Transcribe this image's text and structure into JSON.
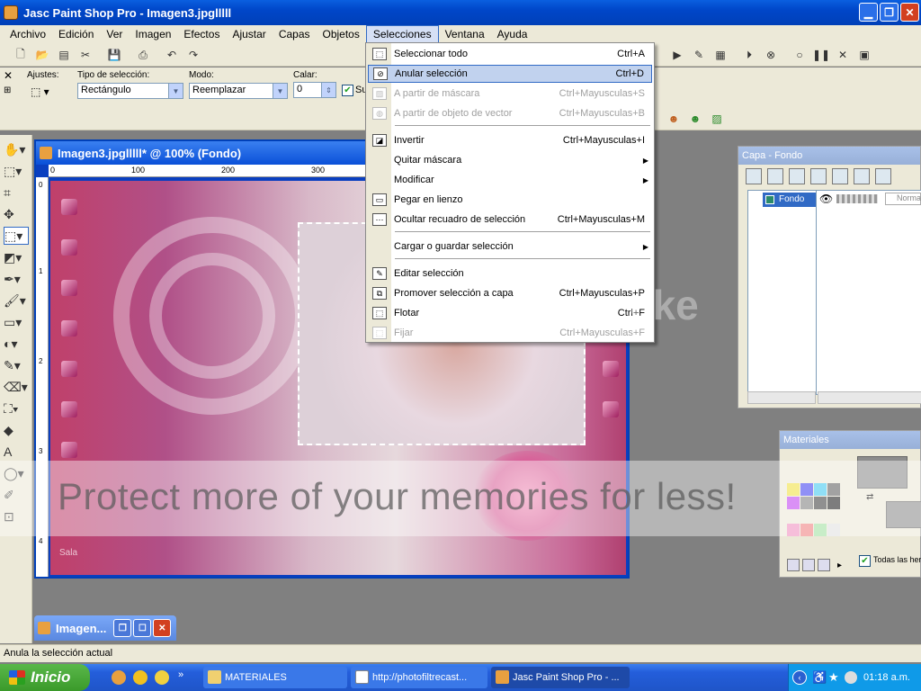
{
  "window": {
    "title": "Jasc Paint Shop Pro - Imagen3.jpglllll"
  },
  "menubar": [
    "Archivo",
    "Edición",
    "Ver",
    "Imagen",
    "Efectos",
    "Ajustar",
    "Capas",
    "Objetos",
    "Selecciones",
    "Ventana",
    "Ayuda"
  ],
  "tool_options": {
    "ajustes_label": "Ajustes:",
    "tipo_label": "Tipo de selección:",
    "tipo_value": "Rectángulo",
    "modo_label": "Modo:",
    "modo_value": "Reemplazar",
    "calar_label": "Calar:",
    "calar_value": "0",
    "su_label": "Su"
  },
  "selecciones_menu": [
    {
      "label": "Seleccionar todo",
      "shortcut": "Ctrl+A",
      "enabled": true,
      "icon": "select-all-icon"
    },
    {
      "label": "Anular selección",
      "shortcut": "Ctrl+D",
      "enabled": true,
      "highlighted": true,
      "icon": "deselect-icon"
    },
    {
      "label": "A partir de máscara",
      "shortcut": "Ctrl+Mayusculas+S",
      "enabled": false,
      "icon": "from-mask-icon"
    },
    {
      "label": "A partir de objeto de vector",
      "shortcut": "Ctrl+Mayusculas+B",
      "enabled": false,
      "icon": "from-vector-icon"
    },
    {
      "label": "Invertir",
      "shortcut": "Ctrl+Mayusculas+I",
      "enabled": true,
      "icon": "invert-icon"
    },
    {
      "label": "Quitar máscara",
      "shortcut": "",
      "enabled": true,
      "submenu": true
    },
    {
      "label": "Modificar",
      "shortcut": "",
      "enabled": true,
      "submenu": true
    },
    {
      "label": "Pegar en lienzo",
      "shortcut": "",
      "enabled": true,
      "icon": "paste-canvas-icon"
    },
    {
      "label": "Ocultar recuadro de selección",
      "shortcut": "Ctrl+Mayusculas+M",
      "enabled": true,
      "icon": "hide-marquee-icon"
    },
    {
      "label": "Cargar o guardar selección",
      "shortcut": "",
      "enabled": true,
      "submenu": true
    },
    {
      "label": "Editar selección",
      "shortcut": "",
      "enabled": true,
      "icon": "edit-selection-icon"
    },
    {
      "label": "Promover selección a capa",
      "shortcut": "Ctrl+Mayusculas+P",
      "enabled": true,
      "icon": "promote-layer-icon"
    },
    {
      "label": "Flotar",
      "shortcut": "Ctrl+F",
      "enabled": true,
      "icon": "float-icon"
    },
    {
      "label": "Fijar",
      "shortcut": "Ctrl+Mayusculas+F",
      "enabled": false,
      "icon": "defloat-icon"
    }
  ],
  "image_window": {
    "title": "Imagen3.jpglllll* @ 100% (Fondo)",
    "ruler_h": [
      "0",
      "100",
      "200",
      "300"
    ],
    "ruler_v": [
      "0",
      "1",
      "2",
      "3",
      "4"
    ]
  },
  "canvas_signature": "Sala",
  "minimized_window": {
    "title": "Imagen..."
  },
  "layer_palette": {
    "title": "Capa - Fondo",
    "layer_name": "Fondo",
    "blend_mode": "Norma"
  },
  "materials_palette": {
    "title": "Materiales",
    "checkbox_label": "Todas las herr"
  },
  "status_text": "Anula la selección actual",
  "taskbar": {
    "start_label": "Inicio",
    "tasks": [
      "MATERIALES",
      "http://photofiltrecast...",
      "Jasc Paint Shop Pro - ..."
    ],
    "clock": "01:18 a.m."
  },
  "overlay": {
    "watermark_text": "Protect more of your memories for less!",
    "logo_text": "cke"
  }
}
